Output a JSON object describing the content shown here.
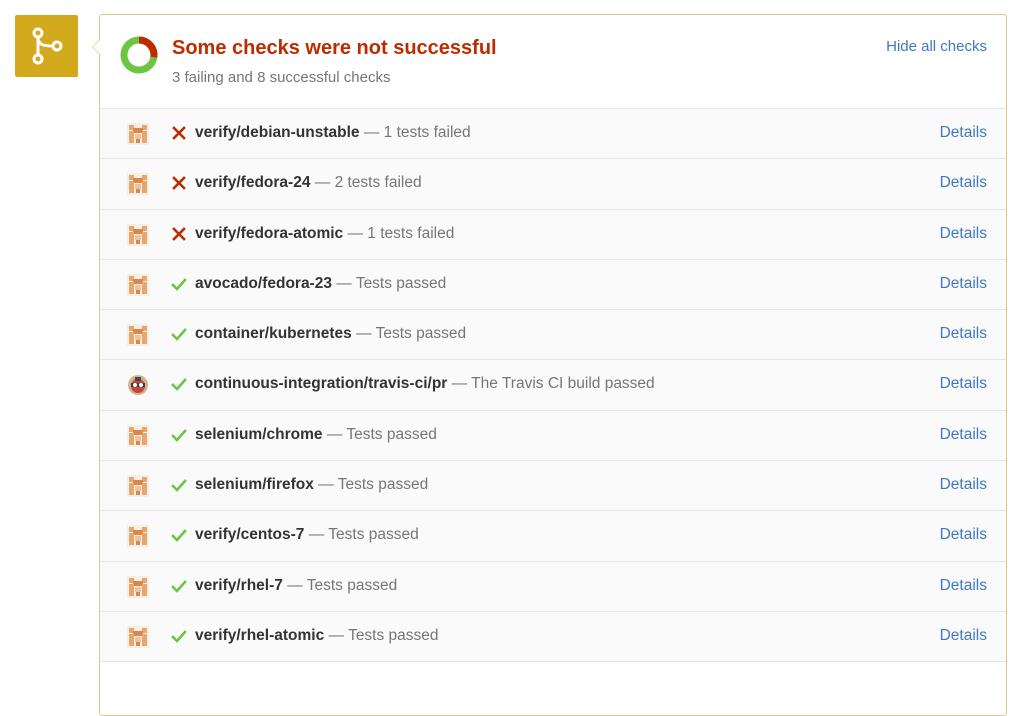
{
  "colors": {
    "badge": "#d3a91d",
    "fail": "#bd2c00",
    "success": "#6cc644",
    "link": "#4078c0"
  },
  "header": {
    "title": "Some checks were not successful",
    "subtitle": "3 failing and 8 successful checks",
    "hide_link": "Hide all checks",
    "failing": 3,
    "successful": 8
  },
  "checks": [
    {
      "context": "verify/debian-unstable",
      "message": "1 tests failed",
      "status": "failure",
      "avatar": "cockpit-avatar",
      "details": "Details"
    },
    {
      "context": "verify/fedora-24",
      "message": "2 tests failed",
      "status": "failure",
      "avatar": "cockpit-avatar",
      "details": "Details"
    },
    {
      "context": "verify/fedora-atomic",
      "message": "1 tests failed",
      "status": "failure",
      "avatar": "cockpit-avatar",
      "details": "Details"
    },
    {
      "context": "avocado/fedora-23",
      "message": "Tests passed",
      "status": "success",
      "avatar": "cockpit-avatar",
      "details": "Details"
    },
    {
      "context": "container/kubernetes",
      "message": "Tests passed",
      "status": "success",
      "avatar": "cockpit-avatar",
      "details": "Details"
    },
    {
      "context": "continuous-integration/travis-ci/pr",
      "message": "The Travis CI build passed",
      "status": "success",
      "avatar": "travis-avatar",
      "details": "Details"
    },
    {
      "context": "selenium/chrome",
      "message": "Tests passed",
      "status": "success",
      "avatar": "cockpit-avatar",
      "details": "Details"
    },
    {
      "context": "selenium/firefox",
      "message": "Tests passed",
      "status": "success",
      "avatar": "cockpit-avatar",
      "details": "Details"
    },
    {
      "context": "verify/centos-7",
      "message": "Tests passed",
      "status": "success",
      "avatar": "cockpit-avatar",
      "details": "Details"
    },
    {
      "context": "verify/rhel-7",
      "message": "Tests passed",
      "status": "success",
      "avatar": "cockpit-avatar",
      "details": "Details"
    },
    {
      "context": "verify/rhel-atomic",
      "message": "Tests passed",
      "status": "success",
      "avatar": "cockpit-avatar",
      "details": "Details"
    }
  ],
  "separator": "—"
}
